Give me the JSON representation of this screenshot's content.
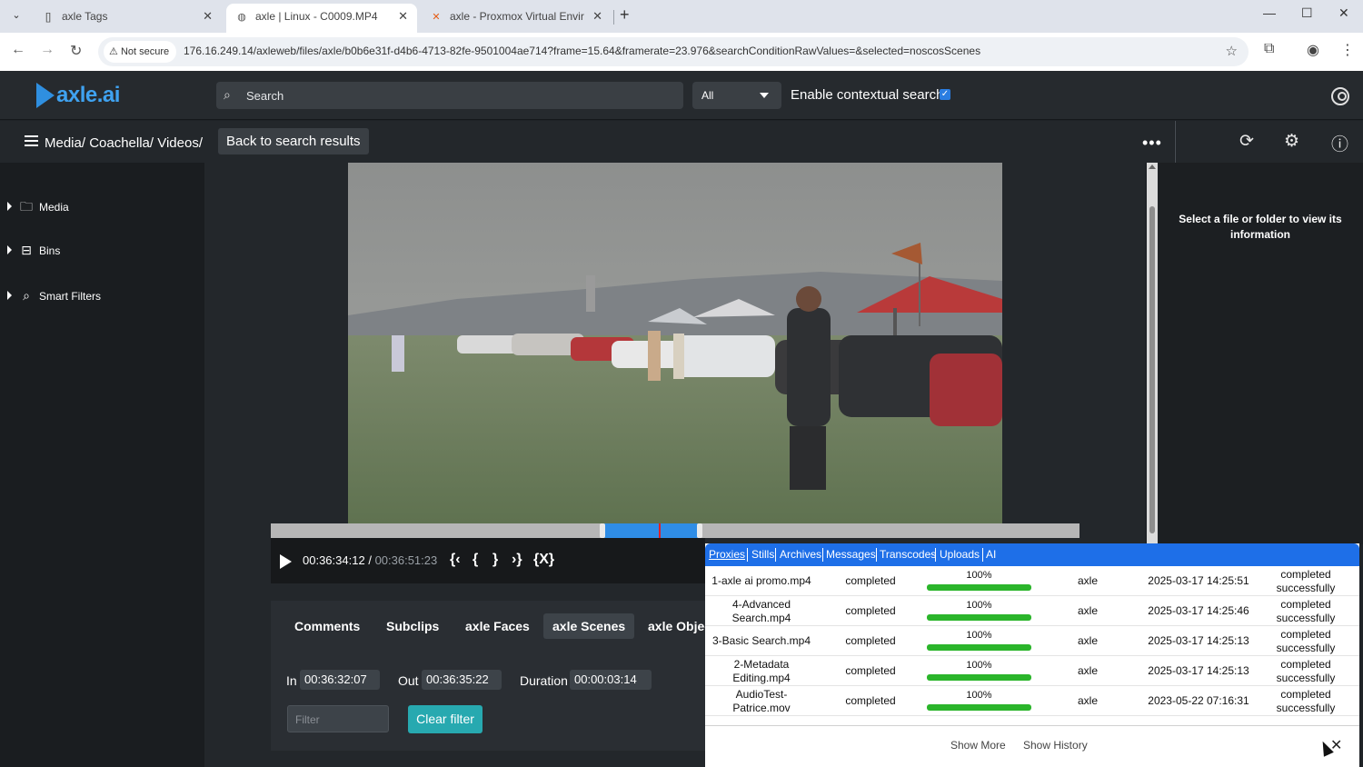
{
  "browser": {
    "tabs": [
      {
        "title": "axle Tags",
        "icon": "tag-page-icon"
      },
      {
        "title": "axle | Linux - C0009.MP4",
        "icon": "globe-icon"
      },
      {
        "title": "axle - Proxmox Virtual Environm",
        "icon": "proxmox-icon"
      }
    ],
    "not_secure": "Not secure",
    "url": "176.16.249.14/axleweb/files/axle/b0b6e31f-d4b6-4713-82fe-9501004ae714?frame=15.64&framerate=23.976&searchConditionRawValues=&selected=noscosScenes"
  },
  "header": {
    "logo": "axle.ai",
    "search_placeholder": "Search",
    "scope": "All",
    "contextual_label": "Enable contextual search",
    "contextual_checked": true
  },
  "breadcrumb": {
    "path": "Media/ Coachella/ Videos/",
    "back_label": "Back to search results",
    "more": "•••"
  },
  "sidebar": {
    "items": [
      {
        "label": "Media",
        "icon": "folder-icon"
      },
      {
        "label": "Bins",
        "icon": "bin-icon"
      },
      {
        "label": "Smart Filters",
        "icon": "search-icon"
      }
    ]
  },
  "player": {
    "current": "00:36:34:12",
    "separator": "/",
    "total": "00:36:51:23",
    "selection_start": 0.41,
    "selection_end": 0.53,
    "playhead": 0.48
  },
  "panel_tabs": [
    "Comments",
    "Subclips",
    "axle Faces",
    "axle Scenes",
    "axle Objec"
  ],
  "active_panel_tab": "axle Scenes",
  "inout": {
    "in_label": "In",
    "in_value": "00:36:32:07",
    "out_label": "Out",
    "out_value": "00:36:35:22",
    "duration_label": "Duration",
    "duration_value": "00:00:03:14",
    "filter_placeholder": "Filter",
    "clear_label": "Clear filter"
  },
  "info_panel": {
    "message": "Select a file or folder to view its information"
  },
  "jobs": {
    "tabs": [
      "Proxies",
      "Stills",
      "Archives",
      "Messages",
      "Transcodes",
      "Uploads",
      "AI"
    ],
    "active_tab": "Proxies",
    "rows": [
      {
        "file": "1-axle ai promo.mp4",
        "status": "completed",
        "progress": "100%",
        "user": "axle",
        "time": "2025-03-17 14:25:51",
        "result": "completed successfully"
      },
      {
        "file": "4-Advanced Search.mp4",
        "status": "completed",
        "progress": "100%",
        "user": "axle",
        "time": "2025-03-17 14:25:46",
        "result": "completed successfully"
      },
      {
        "file": "3-Basic Search.mp4",
        "status": "completed",
        "progress": "100%",
        "user": "axle",
        "time": "2025-03-17 14:25:13",
        "result": "completed successfully"
      },
      {
        "file": "2-Metadata Editing.mp4",
        "status": "completed",
        "progress": "100%",
        "user": "axle",
        "time": "2025-03-17 14:25:13",
        "result": "completed successfully"
      },
      {
        "file": "AudioTest-Patrice.mov",
        "status": "completed",
        "progress": "100%",
        "user": "axle",
        "time": "2023-05-22 07:16:31",
        "result": "completed successfully"
      }
    ],
    "show_more": "Show More",
    "show_history": "Show History"
  },
  "colors": {
    "accent": "#2f8de6",
    "teal_button": "#27a9b0",
    "progress": "#2bb52b",
    "jobs_header": "#1e6fe8"
  }
}
